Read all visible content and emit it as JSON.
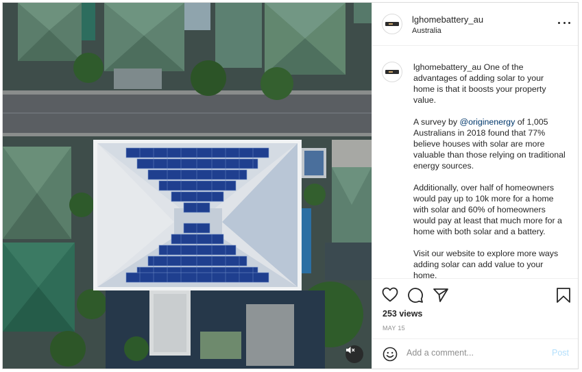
{
  "post": {
    "username": "lghomebattery_au",
    "location": "Australia",
    "caption": {
      "username": "lghomebattery_au",
      "p1_text": " One of the advantages of adding solar to your home is that it boosts your property value.",
      "p2_before": "A survey by ",
      "p2_mention": "@originenergy",
      "p2_after": " of 1,005 Australians in 2018 found that 77% believe houses with solar are more valuable than those relying on traditional energy sources.",
      "p3": "Additionally, over half of homeowners would pay up to 10k more for a home with solar and 60% of homeowners would pay at least that much more for a home with both solar and a battery.",
      "p4": "Visit our website to explore more ways adding solar can add value to your home."
    },
    "views": "253 views",
    "date": "MAY 15",
    "comment_placeholder": "Add a comment...",
    "post_label": "Post"
  },
  "icons": {
    "more": "more-options-icon",
    "like": "heart-icon",
    "comment": "comment-bubble-icon",
    "share": "paper-plane-icon",
    "save": "bookmark-icon",
    "emoji": "smiley-icon",
    "mute": "speaker-muted-icon"
  },
  "colors": {
    "text": "#262626",
    "secondary": "#8e8e8e",
    "mention": "#00376b",
    "post_disabled": "#b2dffc",
    "border": "#efefef"
  }
}
